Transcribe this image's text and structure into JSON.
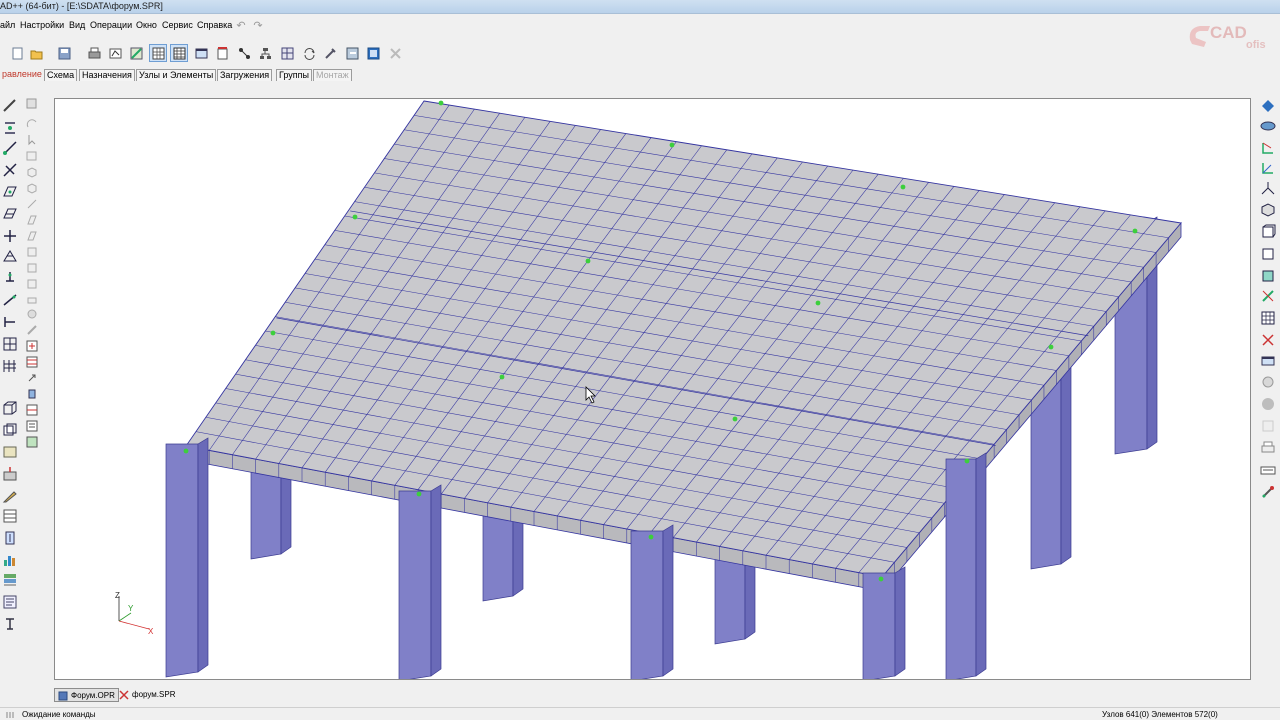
{
  "window": {
    "title": "AD++ (64-бит) - [E:\\SDATA\\форум.SPR]"
  },
  "menu": {
    "items": [
      "айл",
      "Настройки",
      "Вид",
      "Операции",
      "Окно",
      "Сервис",
      "Справка"
    ],
    "undo_icon": "undo-icon",
    "redo_icon": "redo-icon"
  },
  "toolbar": {
    "buttons": [
      "new-file-icon",
      "open-folder-icon",
      "save-icon",
      "print-icon",
      "structure-icon",
      "graphics-icon",
      "grid-mode-icon",
      "table-mode-icon",
      "window-icon",
      "rtf-doc-icon",
      "nodes-icon",
      "hierarchy-icon",
      "mesh-icon",
      "arrows-icon",
      "settings-icon",
      "export-icon",
      "disabled-icon"
    ],
    "active": [
      "grid-mode-icon",
      "table-mode-icon"
    ]
  },
  "tabs": [
    "равление",
    "Схема",
    "Назначения",
    "Узлы и Элементы",
    "Загружения",
    "Группы",
    "Монтаж"
  ],
  "viewport": {
    "axis": {
      "z": "Z",
      "y": "Y",
      "x": "X"
    },
    "colors": {
      "slab_fill": "#c9c9cd",
      "mesh_lines": "#3434a0",
      "column_fill": "#8080c8",
      "node": "#3ccf3c"
    }
  },
  "document_tabs": [
    {
      "label": "Форум.OPR",
      "active": true
    },
    {
      "label": "форум.SPR",
      "active": false
    }
  ],
  "status": {
    "message": "Ожидание команды",
    "counts": "Узлов 641(0) Элементов 572(0)"
  }
}
